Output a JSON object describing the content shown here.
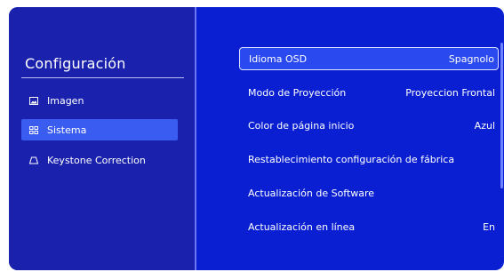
{
  "sidebar": {
    "title": "Configuración",
    "items": [
      {
        "label": "Imagen",
        "icon": "picture-icon",
        "selected": false
      },
      {
        "label": "Sistema",
        "icon": "grid-icon",
        "selected": true
      },
      {
        "label": "Keystone Correction",
        "icon": "keystone-icon",
        "selected": false
      }
    ]
  },
  "menu": {
    "rows": [
      {
        "label": "Idioma OSD",
        "value": "Spagnolo",
        "selected": true
      },
      {
        "label": "Modo de Proyección",
        "value": "Proyeccion Frontal",
        "selected": false
      },
      {
        "label": "Color de página inicio",
        "value": "Azul",
        "selected": false
      },
      {
        "label": "Restablecimiento configuración de fábrica",
        "value": "",
        "selected": false
      },
      {
        "label": "Actualización de Software",
        "value": "",
        "selected": false
      },
      {
        "label": "Actualización en línea",
        "value": "En",
        "selected": false
      }
    ]
  },
  "colors": {
    "background": "#0a1fd2",
    "sidebar": "#1a21ad",
    "selected_highlight": "#3b5cf0",
    "text": "#ffffff"
  }
}
